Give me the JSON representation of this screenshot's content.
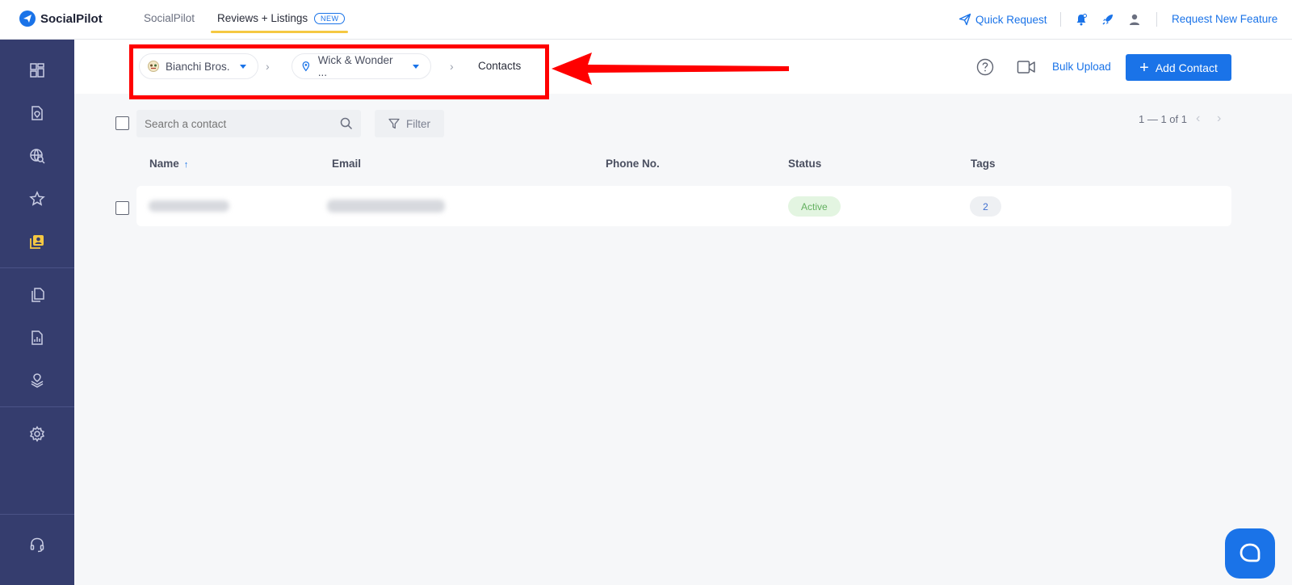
{
  "app": {
    "brand": "SocialPilot"
  },
  "topnav": {
    "tabs": [
      {
        "label": "SocialPilot"
      },
      {
        "label": "Reviews + Listings",
        "badge": "NEW"
      }
    ],
    "quick_request": "Quick Request",
    "request_feature": "Request New Feature"
  },
  "breadcrumb": {
    "brand": "Bianchi Bros.",
    "location": "Wick & Wonder ...",
    "current": "Contacts"
  },
  "header_actions": {
    "bulk_upload": "Bulk Upload",
    "add_contact": "Add Contact"
  },
  "toolbar": {
    "search_placeholder": "Search a contact",
    "filter_label": "Filter",
    "pagination": "1 — 1 of 1"
  },
  "table": {
    "columns": {
      "name": "Name",
      "email": "Email",
      "phone": "Phone No.",
      "status": "Status",
      "tags": "Tags"
    },
    "rows": [
      {
        "status": "Active",
        "tags": "2"
      }
    ]
  },
  "sidebar": {
    "items": [
      "dashboard-icon",
      "location-document-icon",
      "globe-search-icon",
      "star-icon",
      "contacts-icon",
      "copy-pages-icon",
      "report-icon",
      "map-layers-icon",
      "settings-icon",
      "headset-icon"
    ]
  },
  "colors": {
    "accent": "#1a73e8",
    "sidebar": "#353d6e",
    "highlight": "#ff0000",
    "active_status": "#63b05f"
  }
}
